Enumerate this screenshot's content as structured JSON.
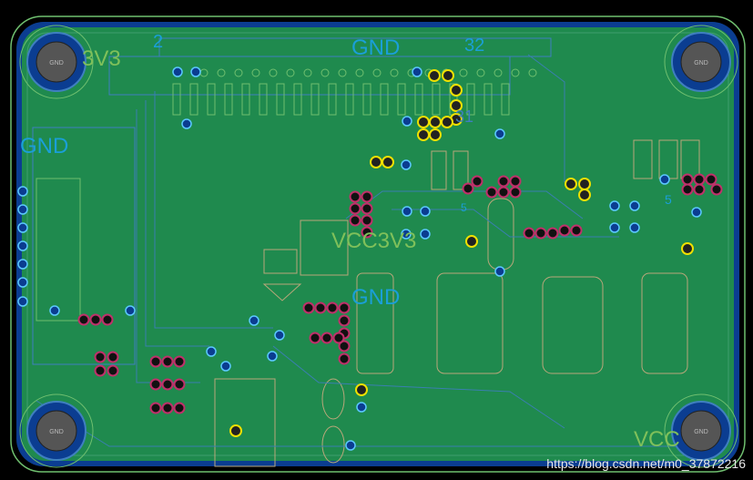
{
  "board": {
    "labels": {
      "gnd_top": "GND",
      "gnd_left": "GND",
      "gnd_mid": "GND",
      "v3v3": "3V3",
      "vcc3v3": "VCC3V3",
      "vcc_bottom": "VCC",
      "pin2": "2",
      "pin32": "32",
      "pin31": "31",
      "pin5a": "5",
      "pin5b": "5"
    },
    "mounting_hole_label": "GND",
    "colors": {
      "background": "#000000",
      "board_fill": "#1f8a4e",
      "board_outline": "#6fbf6f",
      "copper_edge": "#0b3d91",
      "silkscreen": "#b9a77a",
      "via_ring": "#5bc8ff",
      "pad_yellow": "#f0e000",
      "pad_magenta": "#c0306a",
      "label_cyan": "#1a9fd8",
      "label_green": "#7fc05a"
    }
  },
  "watermark": "https://blog.csdn.net/m0_37872216"
}
